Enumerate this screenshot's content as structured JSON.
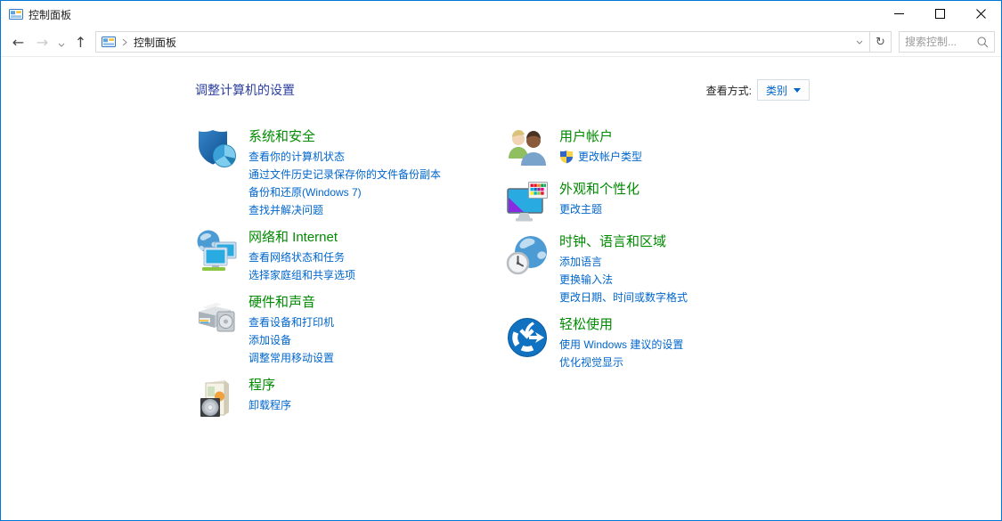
{
  "window": {
    "title": "控制面板"
  },
  "nav": {
    "back": "←",
    "forward": "→",
    "up": "↑",
    "refresh": "↻"
  },
  "address": {
    "breadcrumb": "控制面板"
  },
  "search": {
    "placeholder": "搜索控制..."
  },
  "header": {
    "title": "调整计算机的设置",
    "view_label": "查看方式:",
    "view_value": "类别"
  },
  "icons": {
    "control-panel-icon": "app glyph",
    "minimize-icon": "—",
    "maximize-icon": "▢",
    "close-icon": "✕",
    "breadcrumb-chevron-icon": "›",
    "dropdown-chevron-icon": "⌄",
    "search-icon": "magnifier",
    "view-caret-icon": "▼",
    "uac-shield-icon": "blue-yellow shield"
  },
  "colors": {
    "window_border": "#0078D7",
    "category_title": "#008a00",
    "task_link": "#0066CC",
    "page_title": "#2b3e9f"
  },
  "categories": {
    "left": [
      {
        "title": "系统和安全",
        "icon": "security-shield",
        "links": [
          "查看你的计算机状态",
          "通过文件历史记录保存你的文件备份副本",
          "备份和还原(Windows 7)",
          "查找并解决问题"
        ]
      },
      {
        "title": "网络和 Internet",
        "icon": "network-globe",
        "links": [
          "查看网络状态和任务",
          "选择家庭组和共享选项"
        ]
      },
      {
        "title": "硬件和声音",
        "icon": "printer-hardware",
        "links": [
          "查看设备和打印机",
          "添加设备",
          "调整常用移动设置"
        ]
      },
      {
        "title": "程序",
        "icon": "program-box",
        "links": [
          "卸载程序"
        ]
      }
    ],
    "right": [
      {
        "title": "用户帐户",
        "icon": "user-accounts",
        "links": [
          {
            "text": "更改帐户类型",
            "shield": true
          }
        ]
      },
      {
        "title": "外观和个性化",
        "icon": "appearance-monitor",
        "links": [
          "更改主题"
        ]
      },
      {
        "title": "时钟、语言和区域",
        "icon": "clock-globe",
        "links": [
          "添加语言",
          "更换输入法",
          "更改日期、时间或数字格式"
        ]
      },
      {
        "title": "轻松使用",
        "icon": "ease-of-access",
        "links": [
          "使用 Windows 建议的设置",
          "优化视觉显示"
        ]
      }
    ]
  }
}
